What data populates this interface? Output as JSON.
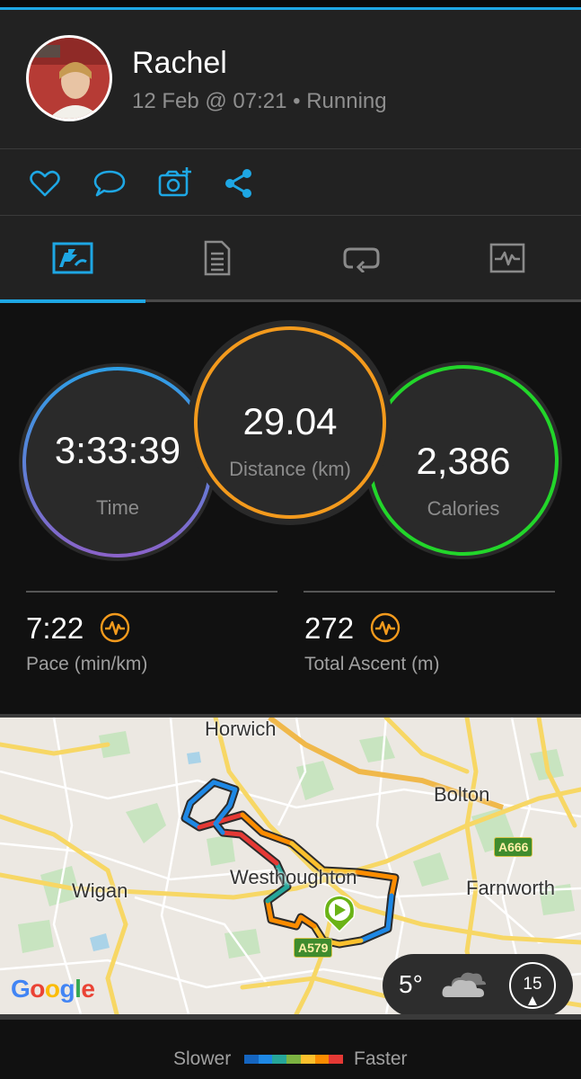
{
  "activity": {
    "user_name": "Rachel",
    "meta": "12 Feb @ 07:21 • Running"
  },
  "actions": [
    {
      "name": "like-icon"
    },
    {
      "name": "comment-icon"
    },
    {
      "name": "add-photo-icon"
    },
    {
      "name": "share-icon"
    }
  ],
  "tabs": [
    {
      "name": "overview-tab",
      "active": true
    },
    {
      "name": "details-tab"
    },
    {
      "name": "laps-tab"
    },
    {
      "name": "charts-tab"
    }
  ],
  "stats": {
    "time": {
      "value": "3:33:39",
      "label": "Time"
    },
    "distance": {
      "value": "29.04",
      "label": "Distance (km)"
    },
    "calories": {
      "value": "2,386",
      "label": "Calories"
    },
    "pace": {
      "value": "7:22",
      "label": "Pace (min/km)"
    },
    "ascent": {
      "value": "272",
      "label": "Total Ascent (m)"
    }
  },
  "map": {
    "labels": {
      "horwich": "Horwich",
      "bolton": "Bolton",
      "westhoughton": "Westhoughton",
      "wigan": "Wigan",
      "farnworth": "Farnworth"
    },
    "roads": {
      "a666": "A666",
      "a579": "A579"
    },
    "attribution": "Google",
    "weather": {
      "temperature": "5°",
      "wind_speed": "15",
      "icon": "cloudy-icon"
    }
  },
  "legend": {
    "slower": "Slower",
    "faster": "Faster",
    "colors": [
      "#1565c0",
      "#1e88e5",
      "#26a69a",
      "#7cb342",
      "#fbc02d",
      "#fb8c00",
      "#e53935"
    ]
  },
  "colors": {
    "accent": "#1ea7e4",
    "distance_ring": "#f39a1d",
    "calories_ring": "#22d62a",
    "metric_icon": "#f39a1d"
  }
}
